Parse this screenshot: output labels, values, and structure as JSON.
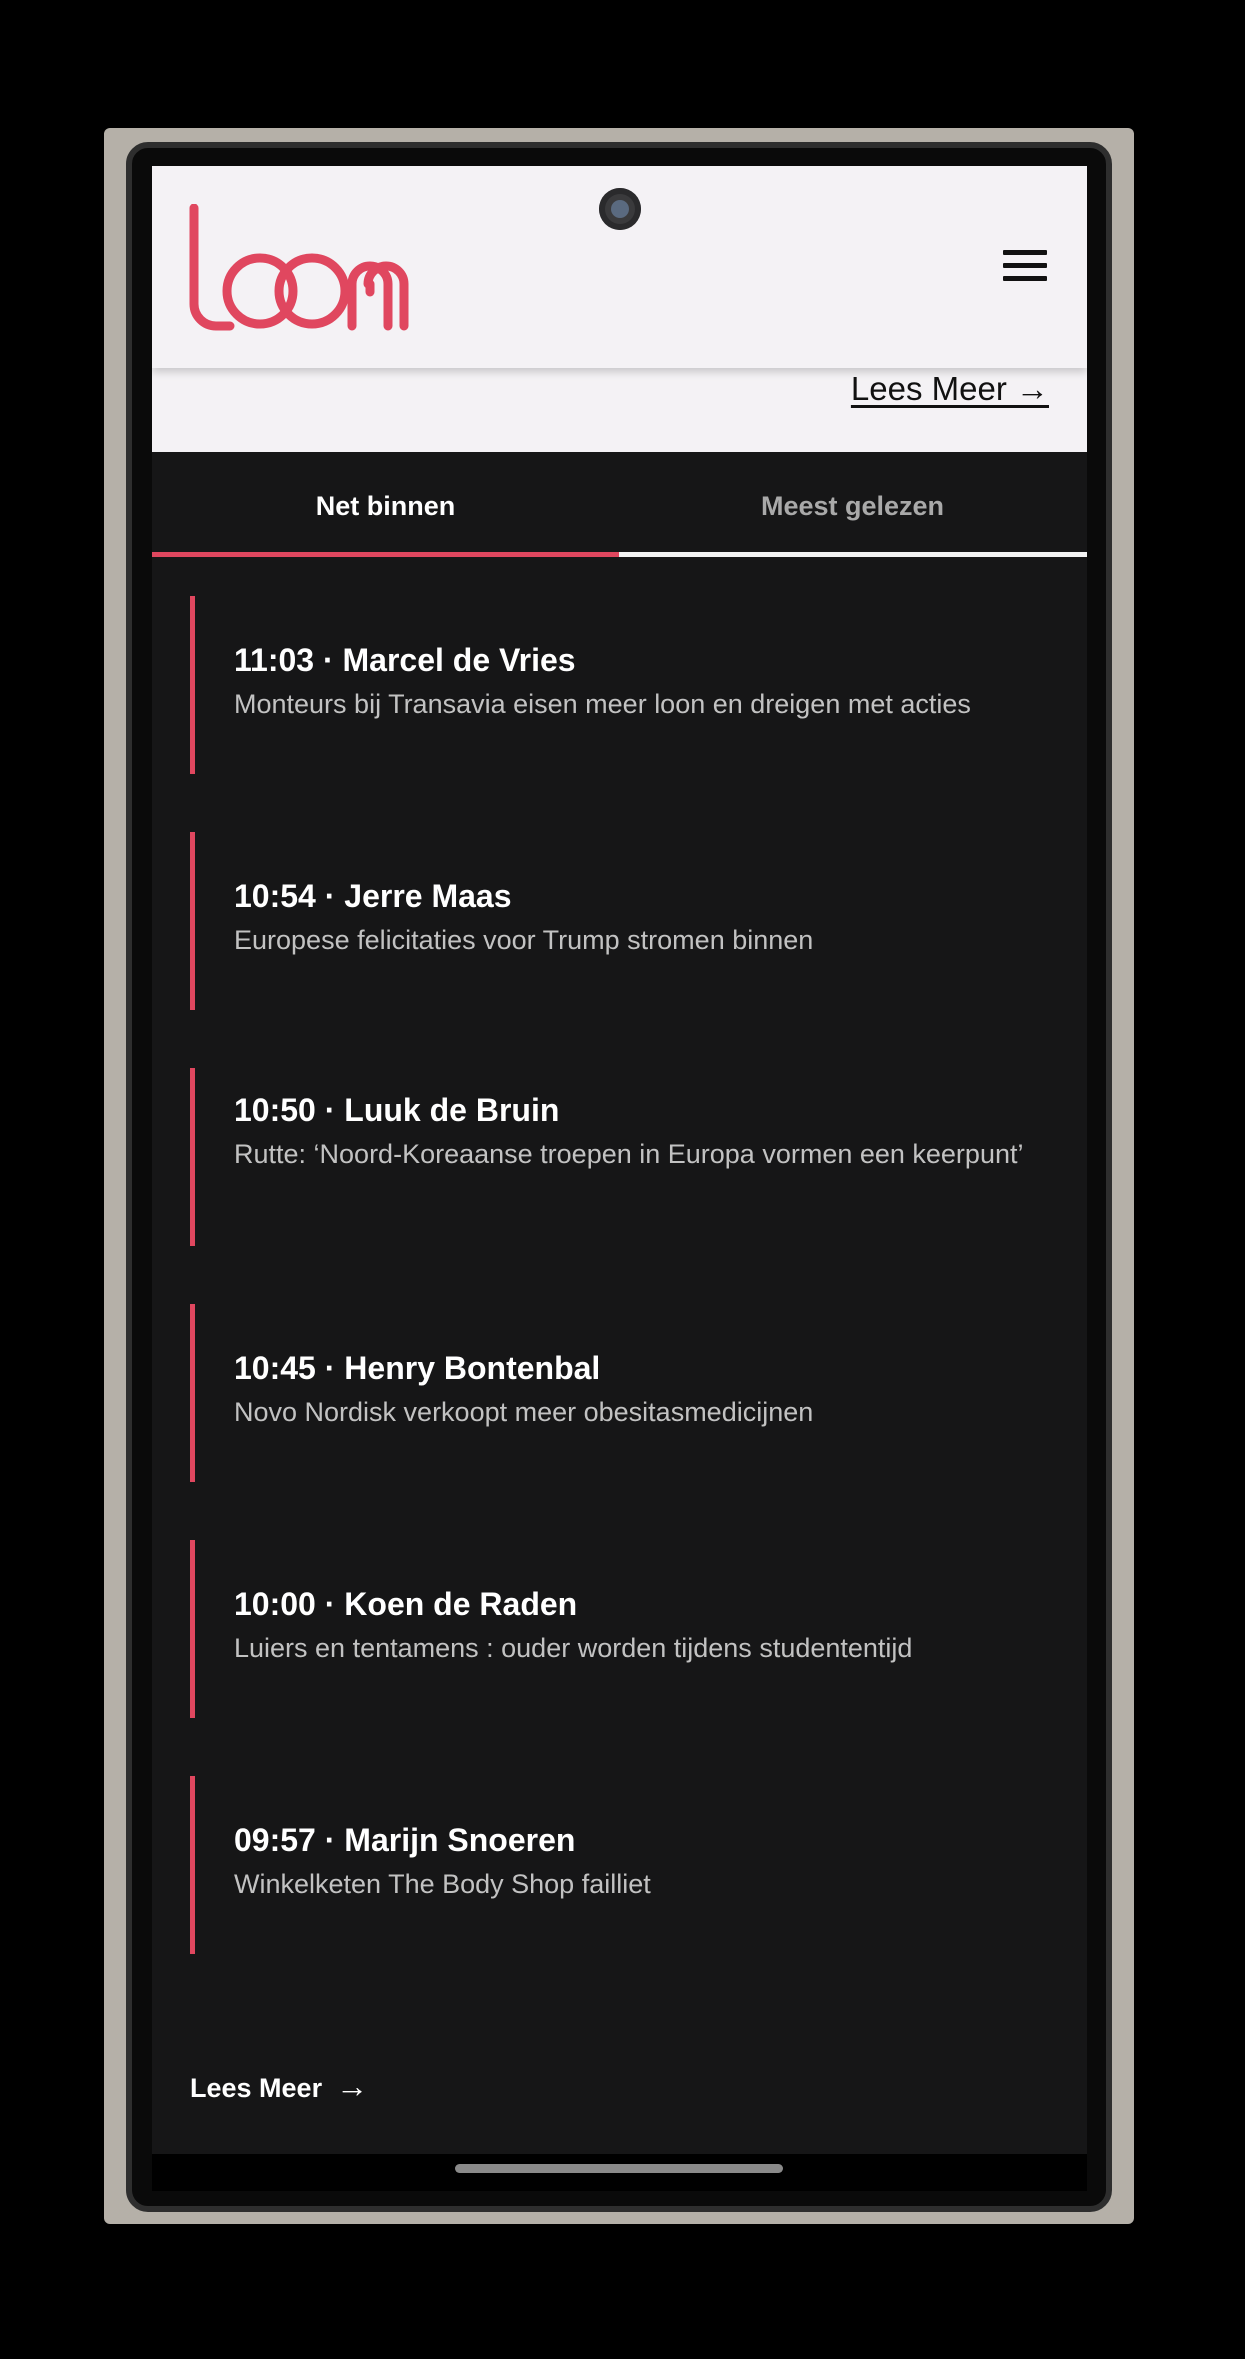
{
  "app": {
    "logo_text": "Loom",
    "brand_color": "#e0475f"
  },
  "header": {
    "menu_icon": "hamburger-menu-icon",
    "top_read_more": "Lees Meer →"
  },
  "tabs": [
    {
      "label": "Net binnen",
      "active": true
    },
    {
      "label": "Meest gelezen",
      "active": false
    }
  ],
  "news": [
    {
      "headline": "11:03 · Marcel de Vries",
      "summary": "Monteurs bij Transavia eisen meer loon en dreigen met acties"
    },
    {
      "headline": "10:54 · Jerre Maas",
      "summary": "Europese felicitaties voor Trump stromen binnen"
    },
    {
      "headline": "10:50 · Luuk de Bruin",
      "summary": "Rutte: ‘Noord-Koreaanse troepen in Europa vormen een keerpunt’"
    },
    {
      "headline": "10:45 · Henry Bontenbal",
      "summary": "Novo Nordisk verkoopt meer obesitasmedicijnen"
    },
    {
      "headline": "10:00 · Koen de Raden",
      "summary": "Luiers en tentamens : ouder worden tijdens studententijd"
    },
    {
      "headline": "09:57 · Marijn Snoeren",
      "summary": "Winkelketen The Body Shop failliet"
    }
  ],
  "footer": {
    "read_more_label": "Lees Meer",
    "arrow": "→"
  }
}
